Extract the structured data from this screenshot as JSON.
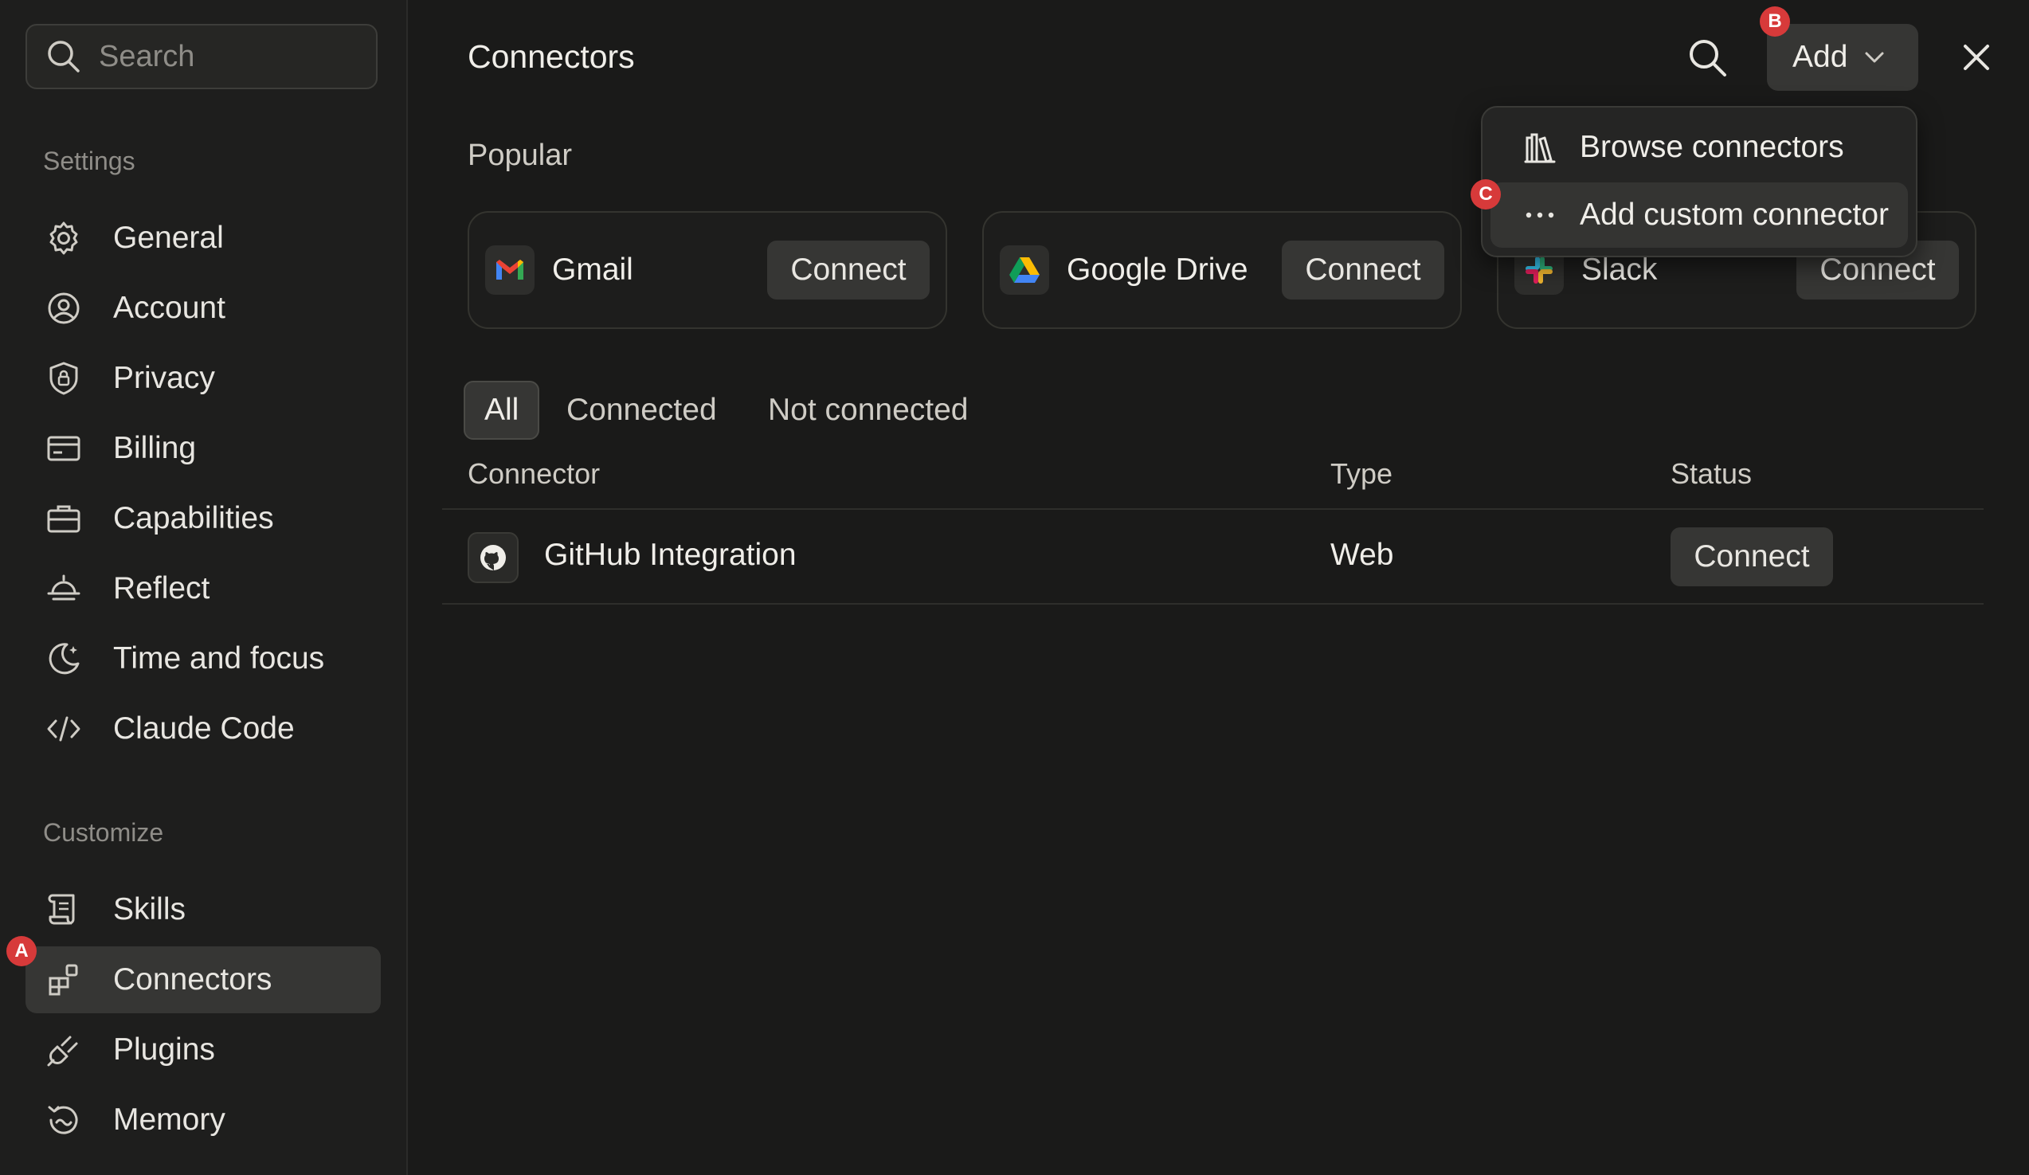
{
  "sidebar": {
    "search_placeholder": "Search",
    "settings_title": "Settings",
    "settings_items": [
      {
        "label": "General",
        "icon": "gear-icon"
      },
      {
        "label": "Account",
        "icon": "user-circle-icon"
      },
      {
        "label": "Privacy",
        "icon": "shield-lock-icon"
      },
      {
        "label": "Billing",
        "icon": "credit-card-icon"
      },
      {
        "label": "Capabilities",
        "icon": "briefcase-icon"
      },
      {
        "label": "Reflect",
        "icon": "sunset-icon"
      },
      {
        "label": "Time and focus",
        "icon": "moon-icon"
      },
      {
        "label": "Claude Code",
        "icon": "code-icon"
      }
    ],
    "customize_title": "Customize",
    "customize_items": [
      {
        "label": "Skills",
        "icon": "scroll-icon"
      },
      {
        "label": "Connectors",
        "icon": "connectors-icon",
        "active": true
      },
      {
        "label": "Plugins",
        "icon": "plug-icon"
      },
      {
        "label": "Memory",
        "icon": "memory-icon"
      }
    ]
  },
  "header": {
    "title": "Connectors",
    "add_label": "Add"
  },
  "dropdown": {
    "items": [
      {
        "label": "Browse connectors",
        "icon": "library-icon"
      },
      {
        "label": "Add custom connector",
        "icon": "more-dots-icon"
      }
    ]
  },
  "popular": {
    "title": "Popular",
    "cards": [
      {
        "name": "Gmail",
        "button": "Connect",
        "icon": "gmail-icon"
      },
      {
        "name": "Google Drive",
        "button": "Connect",
        "icon": "google-drive-icon"
      },
      {
        "name": "Slack",
        "button": "Connect",
        "icon": "slack-icon"
      }
    ]
  },
  "filters": [
    "All",
    "Connected",
    "Not connected"
  ],
  "table": {
    "headers": [
      "Connector",
      "Type",
      "Status"
    ],
    "rows": [
      {
        "name": "GitHub Integration",
        "type": "Web",
        "status": "Connect",
        "icon": "github-icon"
      }
    ]
  },
  "badges": [
    "A",
    "B",
    "C"
  ],
  "colors": {
    "background": "#1a1a19",
    "sidebar": "#1e1e1d",
    "button": "#363634",
    "badge": "#d73a3a"
  }
}
